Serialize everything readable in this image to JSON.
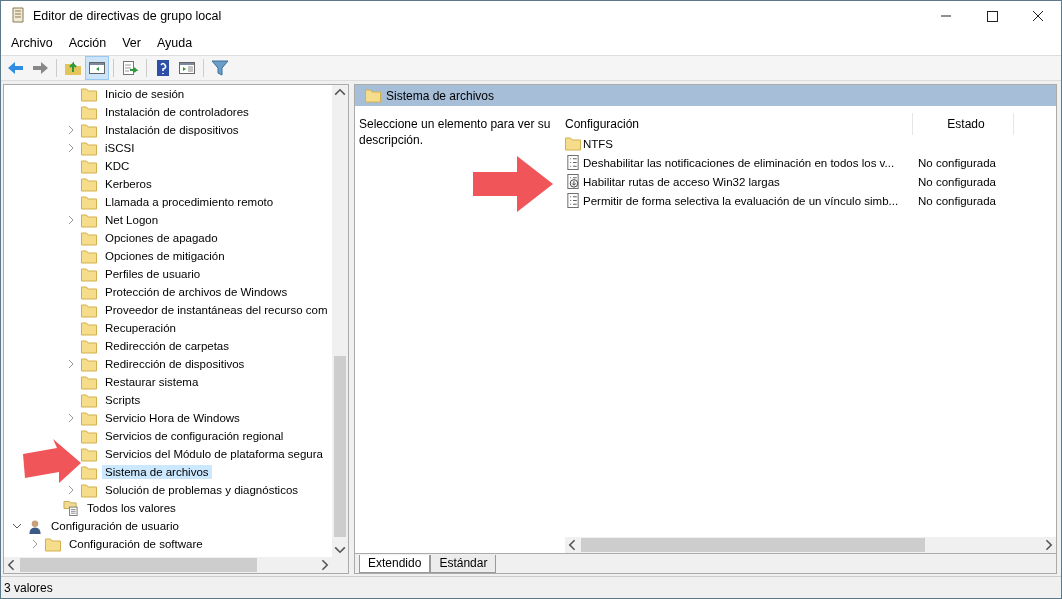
{
  "window": {
    "title": "Editor de directivas de grupo local"
  },
  "menu": [
    "Archivo",
    "Acción",
    "Ver",
    "Ayuda"
  ],
  "tree": [
    {
      "children": [
        {
          "children": [
            {
              "children": [
                {
                  "label": "Inicio de sesión",
                  "kind": "folder",
                  "expandable": false,
                  "selected": false
                },
                {
                  "label": "Instalación de controladores",
                  "kind": "folder",
                  "expandable": false,
                  "selected": false
                },
                {
                  "label": "Instalación de dispositivos",
                  "kind": "folder",
                  "expandable": true,
                  "selected": false
                },
                {
                  "label": "iSCSI",
                  "kind": "folder",
                  "expandable": true,
                  "selected": false
                },
                {
                  "label": "KDC",
                  "kind": "folder",
                  "expandable": false,
                  "selected": false
                },
                {
                  "label": "Kerberos",
                  "kind": "folder",
                  "expandable": false,
                  "selected": false
                },
                {
                  "label": "Llamada a procedimiento remoto",
                  "kind": "folder",
                  "expandable": false,
                  "selected": false
                },
                {
                  "label": "Net Logon",
                  "kind": "folder",
                  "expandable": true,
                  "selected": false
                },
                {
                  "label": "Opciones de apagado",
                  "kind": "folder",
                  "expandable": false,
                  "selected": false
                },
                {
                  "label": "Opciones de mitigación",
                  "kind": "folder",
                  "expandable": false,
                  "selected": false
                },
                {
                  "label": "Perfiles de usuario",
                  "kind": "folder",
                  "expandable": false,
                  "selected": false
                },
                {
                  "label": "Protección de archivos de Windows",
                  "kind": "folder",
                  "expandable": false,
                  "selected": false
                },
                {
                  "label": "Proveedor de instantáneas del recurso com",
                  "kind": "folder",
                  "expandable": false,
                  "selected": false
                },
                {
                  "label": "Recuperación",
                  "kind": "folder",
                  "expandable": false,
                  "selected": false
                },
                {
                  "label": "Redirección de carpetas",
                  "kind": "folder",
                  "expandable": false,
                  "selected": false
                },
                {
                  "label": "Redirección de dispositivos",
                  "kind": "folder",
                  "expandable": true,
                  "selected": false
                },
                {
                  "label": "Restaurar sistema",
                  "kind": "folder",
                  "expandable": false,
                  "selected": false
                },
                {
                  "label": "Scripts",
                  "kind": "folder",
                  "expandable": false,
                  "selected": false
                },
                {
                  "label": "Servicio Hora de Windows",
                  "kind": "folder",
                  "expandable": true,
                  "selected": false
                },
                {
                  "label": "Servicios de configuración regional",
                  "kind": "folder",
                  "expandable": false,
                  "selected": false
                },
                {
                  "label": "Servicios del Módulo de plataforma segura",
                  "kind": "folder",
                  "expandable": false,
                  "selected": false
                },
                {
                  "label": "Sistema de archivos",
                  "kind": "folder",
                  "expandable": false,
                  "selected": true
                },
                {
                  "label": "Solución de problemas y diagnósticos",
                  "kind": "folder",
                  "expandable": true,
                  "selected": false
                }
              ]
            },
            {
              "label": "Todos los valores",
              "kind": "settings",
              "expandable": false,
              "selected": false
            }
          ]
        }
      ]
    },
    {
      "label": "Configuración de usuario",
      "kind": "user",
      "expandable": true,
      "expanded": true,
      "selected": false,
      "children": [
        {
          "label": "Configuración de software",
          "kind": "folder",
          "expandable": true,
          "selected": false
        }
      ]
    }
  ],
  "details": {
    "title": "Sistema de archivos",
    "description": "Seleccione un elemento para ver su descripción.",
    "columns": [
      "Configuración",
      "Estado"
    ],
    "rows": [
      {
        "kind": "folder",
        "name": "NTFS"
      },
      {
        "kind": "policy",
        "name": "Deshabilitar las notificaciones de eliminación en todos los v...",
        "state": "No configurada"
      },
      {
        "kind": "policy-download",
        "name": "Habilitar rutas de acceso Win32 largas",
        "state": "No configurada"
      },
      {
        "kind": "policy",
        "name": "Permitir de forma selectiva la evaluación de un vínculo simb...",
        "state": "No configurada"
      }
    ]
  },
  "tabs": [
    {
      "label": "Extendido",
      "selected": true
    },
    {
      "label": "Estándar",
      "selected": false
    }
  ],
  "status_bar": "3 valores"
}
